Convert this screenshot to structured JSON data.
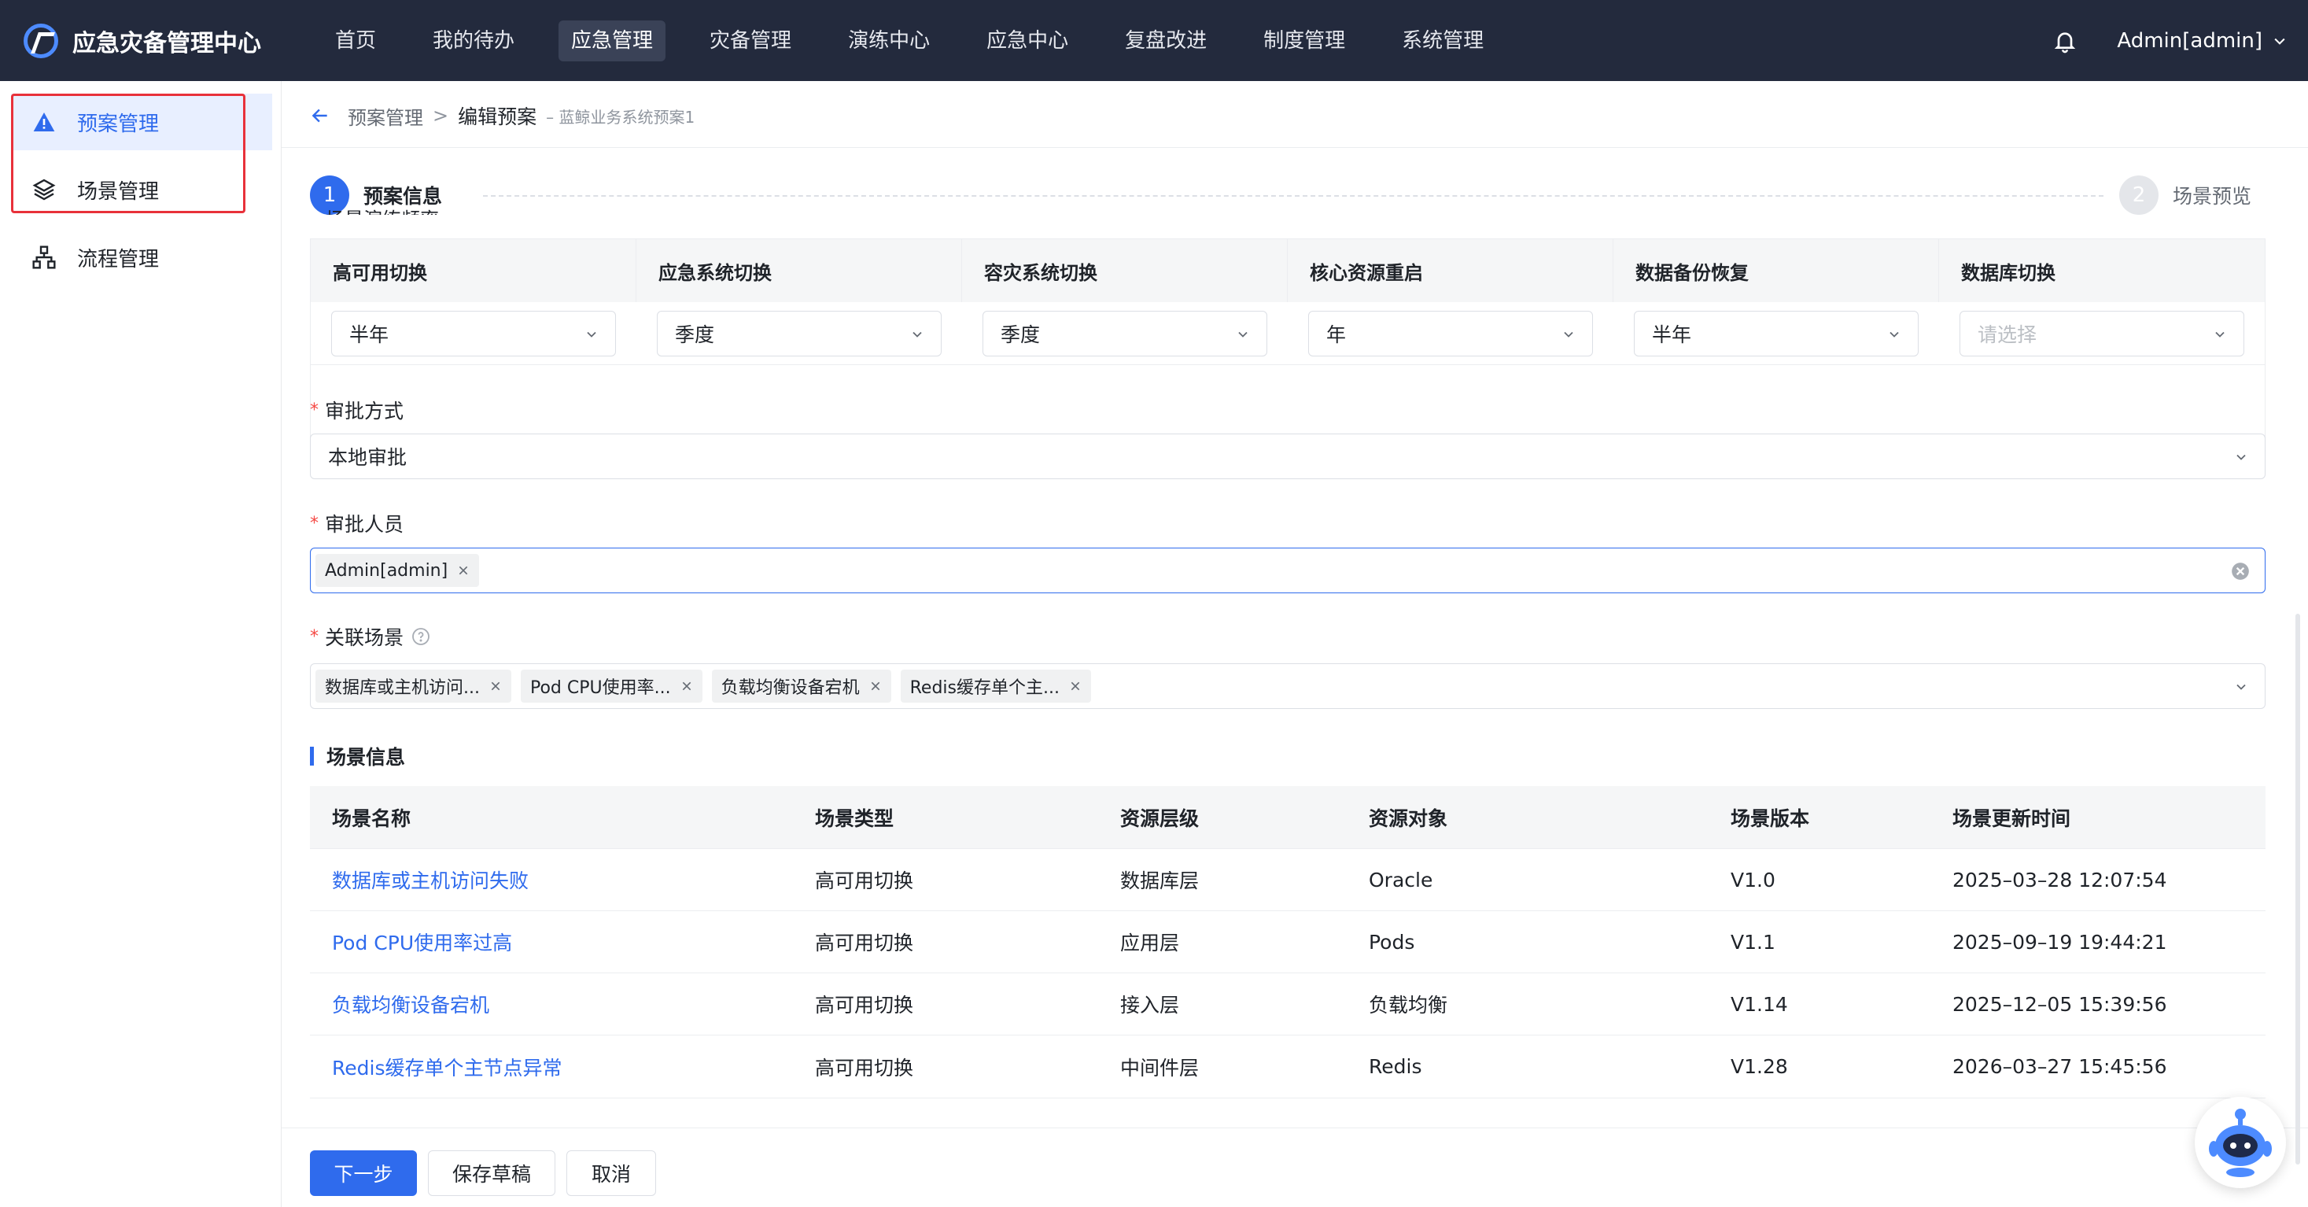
{
  "app": {
    "title": "应急灾备管理中心"
  },
  "topnav": {
    "items": [
      {
        "label": "首页"
      },
      {
        "label": "我的待办"
      },
      {
        "label": "应急管理"
      },
      {
        "label": "灾备管理"
      },
      {
        "label": "演练中心"
      },
      {
        "label": "应急中心"
      },
      {
        "label": "复盘改进"
      },
      {
        "label": "制度管理"
      },
      {
        "label": "系统管理"
      }
    ],
    "active": "应急管理",
    "user": "Admin[admin]"
  },
  "sidebar": {
    "items": [
      {
        "label": "预案管理",
        "icon": "warning-icon",
        "active": true
      },
      {
        "label": "场景管理",
        "icon": "layers-icon"
      },
      {
        "label": "流程管理",
        "icon": "flow-icon"
      }
    ]
  },
  "breadcrumb": {
    "parent": "预案管理",
    "current": "编辑预案",
    "sub": "– 蓝鲸业务系统预案1"
  },
  "steps": [
    {
      "num": "1",
      "label": "预案信息"
    },
    {
      "num": "2",
      "label": "场景预览"
    }
  ],
  "frequency": {
    "partial_label": "场景演练频率",
    "columns": [
      {
        "header": "高可用切换",
        "value": "半年"
      },
      {
        "header": "应急系统切换",
        "value": "季度"
      },
      {
        "header": "容灾系统切换",
        "value": "季度"
      },
      {
        "header": "核心资源重启",
        "value": "年"
      },
      {
        "header": "数据备份恢复",
        "value": "半年"
      },
      {
        "header": "数据库切换",
        "value": "",
        "placeholder": "请选择"
      }
    ]
  },
  "form": {
    "approval_method": {
      "label": "审批方式",
      "value": "本地审批"
    },
    "approvers": {
      "label": "审批人员",
      "tags": [
        "Admin[admin]"
      ]
    },
    "related_scenes": {
      "label": "关联场景",
      "tags": [
        "数据库或主机访问...",
        "Pod CPU使用率...",
        "负载均衡设备宕机",
        "Redis缓存单个主..."
      ]
    }
  },
  "scene_info": {
    "title": "场景信息",
    "headers": [
      "场景名称",
      "场景类型",
      "资源层级",
      "资源对象",
      "场景版本",
      "场景更新时间"
    ],
    "rows": [
      [
        "数据库或主机访问失败",
        "高可用切换",
        "数据库层",
        "Oracle",
        "V1.0",
        "2025–03–28 12:07:54"
      ],
      [
        "Pod CPU使用率过高",
        "高可用切换",
        "应用层",
        "Pods",
        "V1.1",
        "2025–09–19 19:44:21"
      ],
      [
        "负载均衡设备宕机",
        "高可用切换",
        "接入层",
        "负载均衡",
        "V1.14",
        "2025–12–05 15:39:56"
      ],
      [
        "Redis缓存单个主节点异常",
        "高可用切换",
        "中间件层",
        "Redis",
        "V1.28",
        "2026–03–27 15:45:56"
      ]
    ]
  },
  "footer": {
    "next": "下一步",
    "save": "保存草稿",
    "cancel": "取消"
  },
  "colors": {
    "primary": "#2f6bed",
    "topbar": "#232a3d",
    "highlight_box": "#e8313a"
  }
}
